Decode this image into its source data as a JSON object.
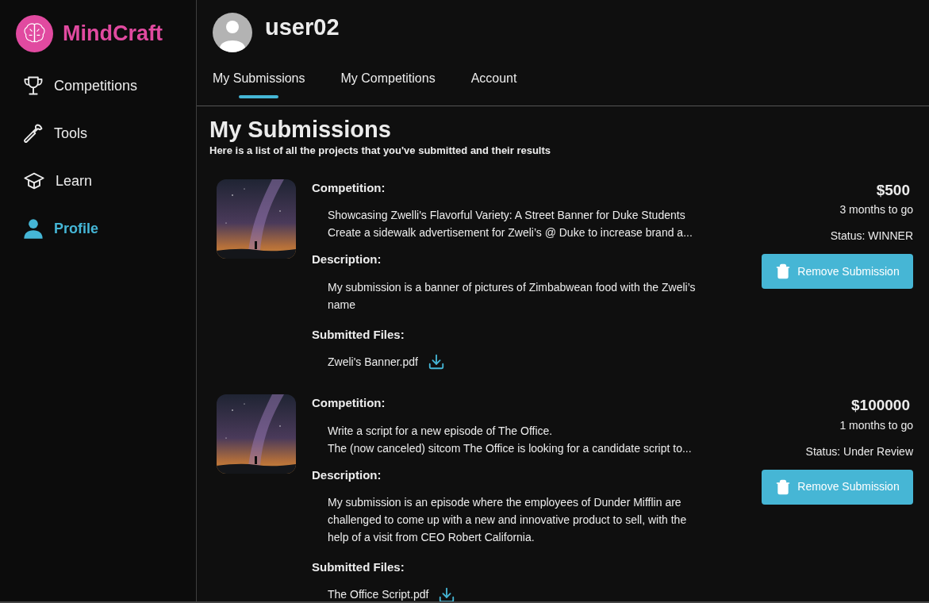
{
  "brand": {
    "name": "MindCraft"
  },
  "sidebar": {
    "items": [
      {
        "label": "Competitions",
        "kind": "trophy",
        "selected": false
      },
      {
        "label": "Tools",
        "kind": "hammer",
        "selected": false
      },
      {
        "label": "Learn",
        "kind": "cap",
        "selected": false
      },
      {
        "label": "Profile",
        "kind": "person",
        "selected": true
      }
    ]
  },
  "user": {
    "name": "user02"
  },
  "tabs": [
    {
      "label": "My Submissions",
      "selected": true
    },
    {
      "label": "My Competitions",
      "selected": false
    },
    {
      "label": "Account",
      "selected": false
    }
  ],
  "page": {
    "title": "My Submissions",
    "subtitle": "Here is a list of all the projects that you've submitted and their results"
  },
  "submissions": [
    {
      "competition_label": "Competition:",
      "competition_title": "Showcasing Zwelli's Flavorful Variety: A Street Banner for Duke Students",
      "competition_summary": "Create a sidewalk advertisement for Zweli’s @ Duke to increase brand a...",
      "description_label": "Description:",
      "description": "My submission is a banner of pictures of Zimbabwean food with the Zweli’s name",
      "files_label": "Submitted Files:",
      "file": "Zweli's Banner.pdf",
      "prize": "$500",
      "time_left": "3 months to go",
      "status": "Status: WINNER",
      "remove_button": "Remove Submission"
    },
    {
      "competition_label": "Competition:",
      "competition_title": "Write a script for a new episode of The Office.",
      "competition_summary": "The (now canceled) sitcom The Office is looking for a candidate script to...",
      "description_label": "Description:",
      "description": "My submission is an episode where the employees of Dunder Mifflin are challenged to come up with a new and innovative product to sell, with the help of a visit from CEO Robert California.",
      "files_label": "Submitted Files:",
      "file": "The Office Script.pdf",
      "prize": "$100000",
      "time_left": "1 months to go",
      "status": "Status: Under Review",
      "remove_button": "Remove Submission"
    }
  ]
}
